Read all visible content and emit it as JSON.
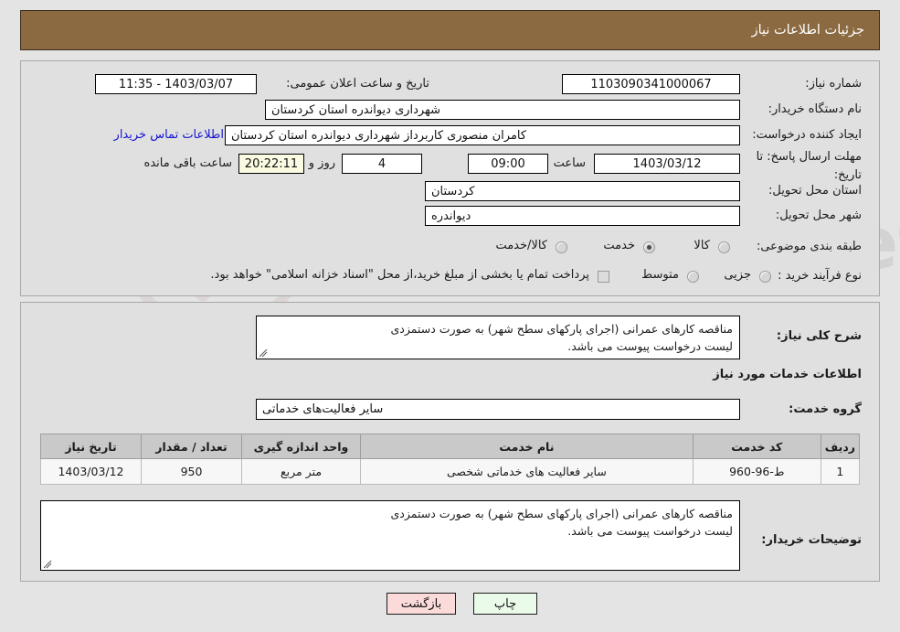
{
  "header": {
    "title": "جزئیات اطلاعات نیاز"
  },
  "top_form": {
    "need_number_label": "شماره نیاز:",
    "need_number_value": "1103090341000067",
    "public_announce_label": "تاریخ و ساعت اعلان عمومی:",
    "public_announce_value": "1403/03/07 - 11:35",
    "buyer_org_label": "نام دستگاه خریدار:",
    "buyer_org_value": "شهرداری دیواندره استان کردستان",
    "requester_label": "ایجاد کننده درخواست:",
    "requester_value": "کامران منصوری کاربرداز شهرداری دیواندره استان کردستان",
    "buyer_contact_link": "اطلاعات تماس خریدار",
    "deadline_label_line1": "مهلت ارسال پاسخ: تا",
    "deadline_label_line2": "تاریخ:",
    "deadline_date": "1403/03/12",
    "hour_label": "ساعت",
    "hour_value": "09:00",
    "days_value": "4",
    "days_and_label": "روز و",
    "countdown_value": "20:22:11",
    "remaining_label": "ساعت باقی مانده",
    "province_label": "استان محل تحویل:",
    "province_value": "کردستان",
    "city_label": "شهر محل تحویل:",
    "city_value": "دیواندره",
    "category_label": "طبقه بندی موضوعی:",
    "category_options": [
      {
        "label": "کالا",
        "selected": false
      },
      {
        "label": "خدمت",
        "selected": true
      },
      {
        "label": "کالا/خدمت",
        "selected": false
      }
    ],
    "process_label": "نوع فرآیند خرید :",
    "process_options": [
      {
        "label": "جزیی",
        "selected": false
      },
      {
        "label": "متوسط",
        "selected": false
      }
    ],
    "treasury_checkbox_label": "پرداخت تمام یا بخشی از مبلغ خرید،از محل \"اسناد خزانه اسلامی\" خواهد بود.",
    "treasury_checked": false
  },
  "description": {
    "general_label": "شرح کلی نیاز:",
    "general_line1": "مناقصه کارهای عمرانی (اجرای پارکهای سطح شهر) به صورت دستمزدی",
    "general_line2": "لیست درخواست پیوست می باشد.",
    "services_heading": "اطلاعات خدمات مورد نیاز",
    "service_group_label": "گروه خدمت:",
    "service_group_value": "سایر فعالیت‌های خدماتی"
  },
  "table": {
    "headers": [
      "ردیف",
      "کد خدمت",
      "نام خدمت",
      "واحد اندازه گیری",
      "تعداد / مقدار",
      "تاریخ نیاز"
    ],
    "rows": [
      {
        "row": "1",
        "code": "ط-96-960",
        "name": "سایر فعالیت های خدماتی شخصی",
        "unit": "متر مربع",
        "quantity": "950",
        "date": "1403/03/12"
      }
    ]
  },
  "buyer_notes": {
    "label": "توضیحات خریدار:",
    "line1": "مناقصه کارهای عمرانی (اجرای پارکهای سطح شهر) به صورت دستمزدی",
    "line2": "لیست درخواست پیوست می باشد."
  },
  "footer": {
    "print_label": "چاپ",
    "back_label": "بازگشت"
  },
  "watermark": {
    "text": "AriaTender.net"
  },
  "colors": {
    "header_bg": "#8b6a42",
    "panel_bg": "#e0e0e0",
    "page_bg": "#e4e4e4",
    "link": "#1414d2",
    "countdown_bg": "#fbfbe3",
    "print_btn_bg": "#eafbe9",
    "back_btn_bg": "#fbdada",
    "table_header_bg": "#c9c9c9"
  }
}
